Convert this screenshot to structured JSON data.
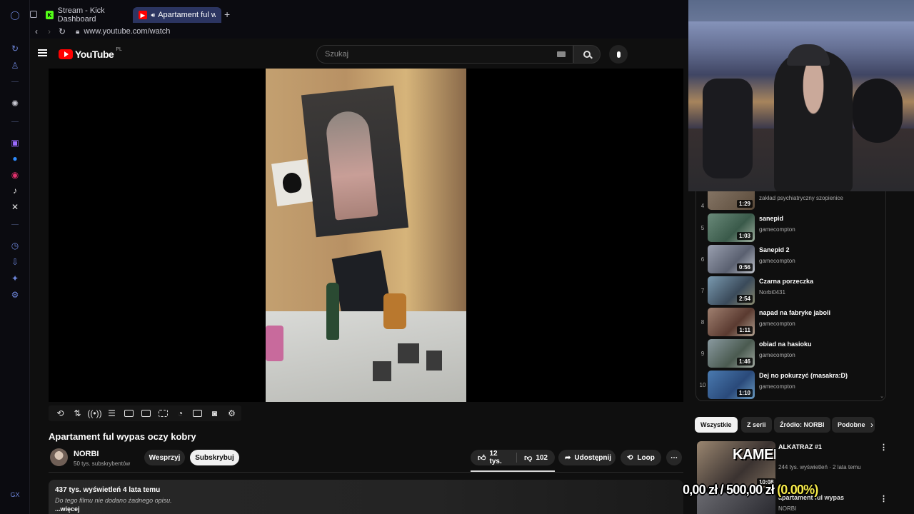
{
  "browser": {
    "tabs": [
      {
        "label": "Stream - Kick Dashboard",
        "favicon": "K"
      },
      {
        "label": "Apartament ful wypas",
        "favicon": "yt"
      }
    ],
    "url": "www.youtube.com/watch"
  },
  "youtube": {
    "logo_text": "YouTube",
    "country_code": "PL",
    "search_placeholder": "Szukaj"
  },
  "video": {
    "title": "Apartament ful wypas oczy kobry",
    "channel": {
      "name": "NORBI",
      "subscribers": "50 tys. subskrybentów"
    },
    "support_label": "Wesprzyj",
    "subscribe_label": "Subskrybuj",
    "likes": "12 tys.",
    "dislikes": "102",
    "share_label": "Udostępnij",
    "loop_label": "Loop",
    "description": {
      "meta": "437 tys. wyświetleń  4 lata temu",
      "text": "Do tego filmu nie dodano żadnego opisu.",
      "more": "...więcej"
    }
  },
  "playlist": {
    "items": [
      {
        "index": "4",
        "title": "",
        "channel": "zakład psychiatryczny szopienice",
        "duration": "1:29"
      },
      {
        "index": "5",
        "title": "sanepid",
        "channel": "gamecompton",
        "duration": "1:03"
      },
      {
        "index": "6",
        "title": "Sanepid 2",
        "channel": "gamecompton",
        "duration": "0:56"
      },
      {
        "index": "7",
        "title": "Czarna porzeczka",
        "channel": "Norbi0431",
        "duration": "2:54"
      },
      {
        "index": "8",
        "title": "napad na fabryke jaboli",
        "channel": "gamecompton",
        "duration": "1:11"
      },
      {
        "index": "9",
        "title": "obiad na hasioku",
        "channel": "gamecompton",
        "duration": "1:46"
      },
      {
        "index": "10",
        "title": "Dej no pokurzyć (masakra:D)",
        "channel": "gamecompton",
        "duration": "1:10"
      }
    ]
  },
  "chips": [
    "Wszystkie",
    "Z serii",
    "Źródło: NORBI",
    "Podobne"
  ],
  "recommendations": [
    {
      "title": "ALKATRAZ #1",
      "meta": "244 tys. wyświetleń · 2 lata temu",
      "duration": "10:08",
      "thumb_text": "KAMERKA"
    },
    {
      "title": "apartament ful wypas",
      "channel": "NORBI"
    }
  ],
  "donation": {
    "current": "0,00 zł",
    "separator": "/",
    "goal": "500,00 zł",
    "percent": "(0.00%)"
  },
  "colors": {
    "yt_red": "#ff0000",
    "tab_active": "#2c3561",
    "opera_icon": "#6c84d8",
    "donation_percent": "#f5e94a"
  }
}
